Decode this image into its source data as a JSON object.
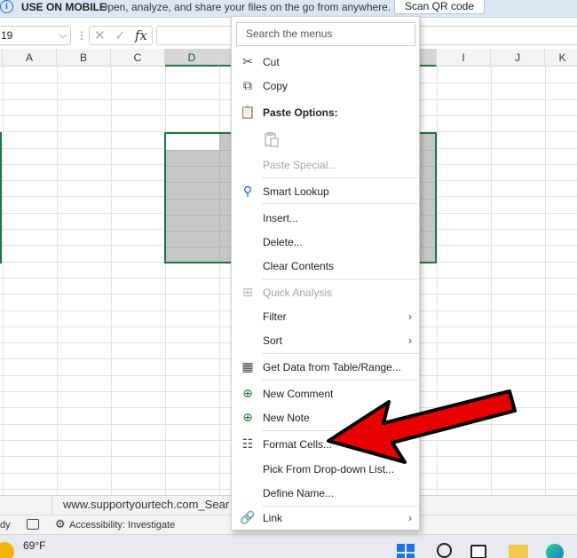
{
  "notification": {
    "title": "USE ON MOBILE",
    "message": "Open, analyze, and share your files on the go from anywhere.",
    "button": "Scan QR code",
    "icon": "info-icon"
  },
  "formula_bar": {
    "name_box": "19",
    "input_value": ""
  },
  "columns": [
    "A",
    "B",
    "C",
    "D",
    "I",
    "J",
    "K"
  ],
  "selected_column": "D",
  "context_menu": {
    "search_placeholder": "Search the menus",
    "items": [
      {
        "label": "Cut",
        "icon": "scissors-icon",
        "enabled": true
      },
      {
        "label": "Copy",
        "icon": "copy-icon",
        "enabled": true
      },
      {
        "label": "Paste Options:",
        "icon": "paste-icon",
        "enabled": true,
        "header": true
      },
      {
        "label": "Paste Special...",
        "enabled": false
      },
      {
        "label": "Smart Lookup",
        "icon": "smart-lookup-icon",
        "enabled": true
      },
      {
        "label": "Insert...",
        "enabled": true
      },
      {
        "label": "Delete...",
        "enabled": true
      },
      {
        "label": "Clear Contents",
        "enabled": true
      },
      {
        "label": "Quick Analysis",
        "icon": "quick-analysis-icon",
        "enabled": false
      },
      {
        "label": "Filter",
        "enabled": true,
        "submenu": true
      },
      {
        "label": "Sort",
        "enabled": true,
        "submenu": true
      },
      {
        "label": "Get Data from Table/Range...",
        "icon": "table-icon",
        "enabled": true
      },
      {
        "label": "New Comment",
        "icon": "new-comment-icon",
        "enabled": true
      },
      {
        "label": "New Note",
        "icon": "new-note-icon",
        "enabled": true
      },
      {
        "label": "Format Cells...",
        "icon": "format-cells-icon",
        "enabled": true
      },
      {
        "label": "Pick From Drop-down List...",
        "enabled": true
      },
      {
        "label": "Define Name...",
        "enabled": true
      },
      {
        "label": "Link",
        "icon": "link-icon",
        "enabled": true,
        "submenu": true
      }
    ]
  },
  "sheet_tab": "www.supportyourtech.com_Sear",
  "status_bar": {
    "ready": "dy",
    "accessibility": "Accessibility: Investigate"
  },
  "taskbar": {
    "temperature": "69°F"
  },
  "colors": {
    "excel_green": "#217346",
    "selection_gray": "#c6c6c6",
    "annotation_red": "#e60000"
  }
}
